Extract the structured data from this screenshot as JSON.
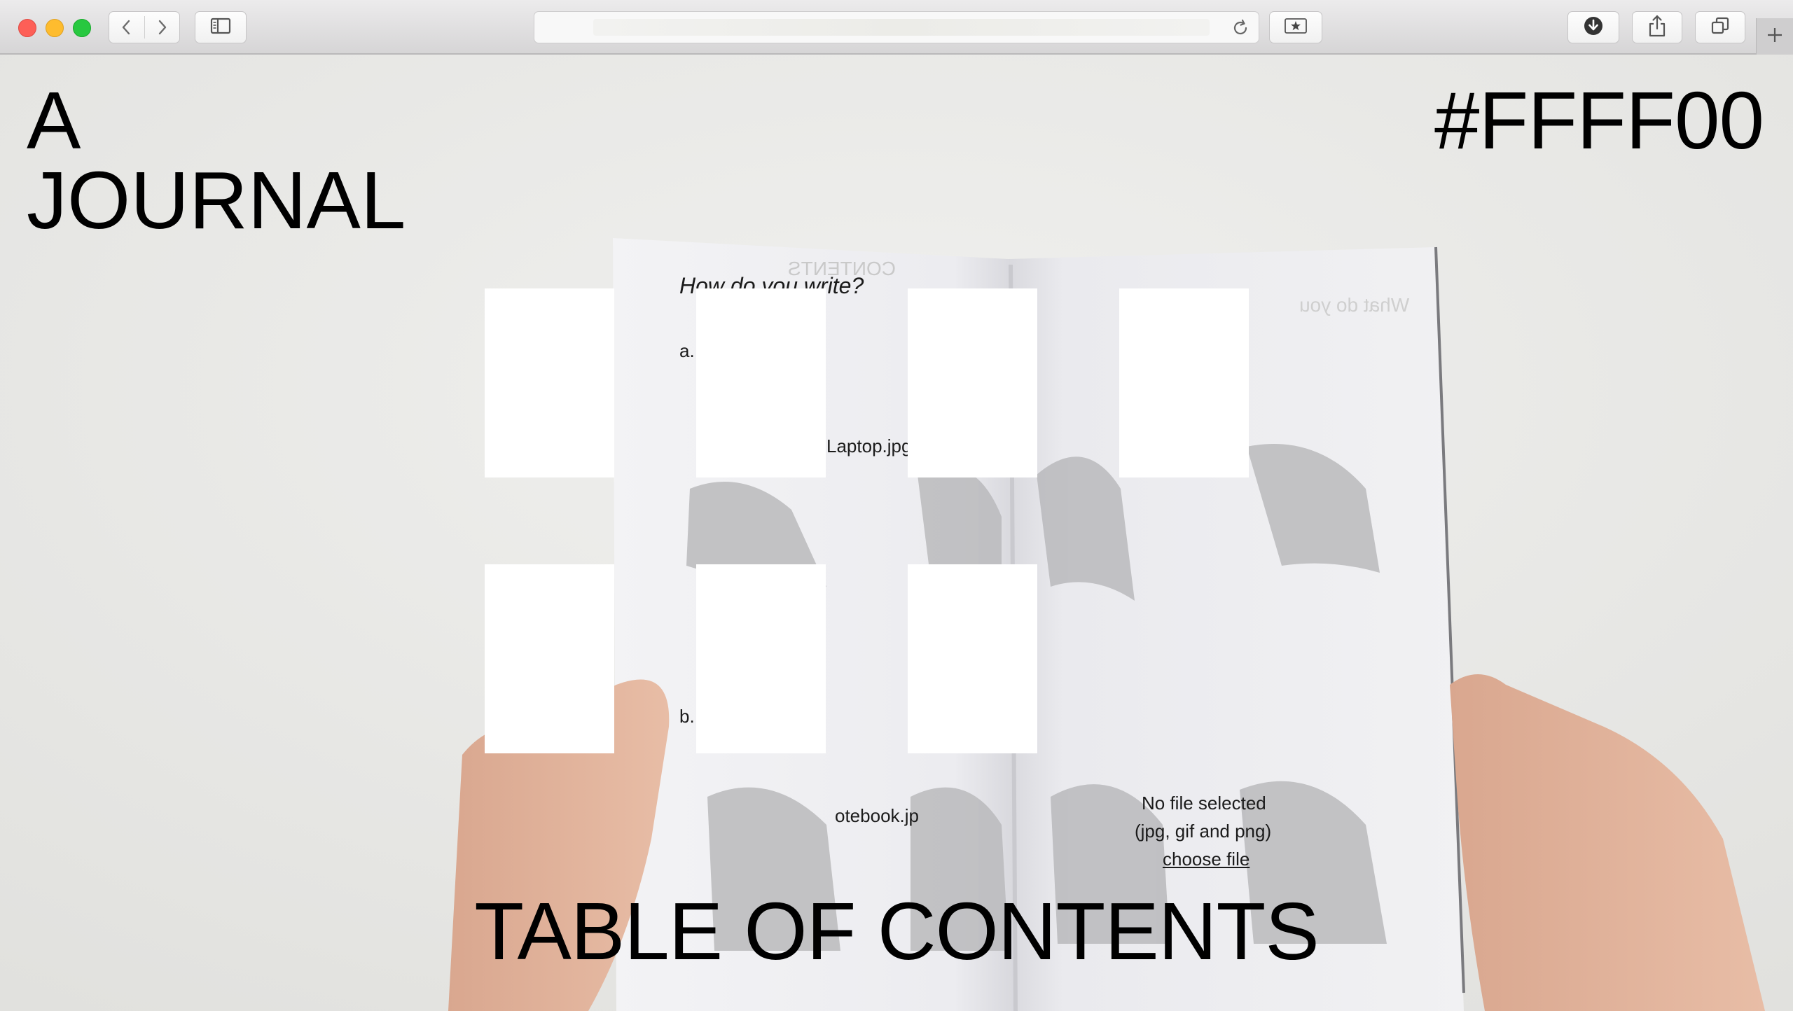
{
  "browser": {
    "back_icon": "chevron-left-icon",
    "forward_icon": "chevron-right-icon",
    "sidebar_icon": "sidebar-icon",
    "reload_icon": "reload-icon",
    "bookmark_icon": "star-icon",
    "download_icon": "download-icon",
    "share_icon": "share-icon",
    "tabs_icon": "tabs-icon",
    "new_tab_icon": "plus-icon",
    "address_value": ""
  },
  "page": {
    "title_line1": "A",
    "title_line2": "JOURNAL",
    "hex_label": "#FFFF00",
    "footer_title": "TABLE OF CONTENTS",
    "background_photo": {
      "question": "How do you write?",
      "option_a_marker": "a.",
      "option_b_marker": "b.",
      "file_a": "Laptop.jpg",
      "file_b": "otebook.jp",
      "mirrored_heading": "CONTENTS",
      "mirrored_question": "What do you",
      "upload_status": "No file selected",
      "upload_types": "(jpg, gif and png)",
      "upload_link": "choose file"
    },
    "cards": [
      {
        "id": "1"
      },
      {
        "id": "2"
      },
      {
        "id": "3"
      },
      {
        "id": "4"
      },
      {
        "id": "5"
      },
      {
        "id": "6"
      },
      {
        "id": "7"
      }
    ]
  }
}
